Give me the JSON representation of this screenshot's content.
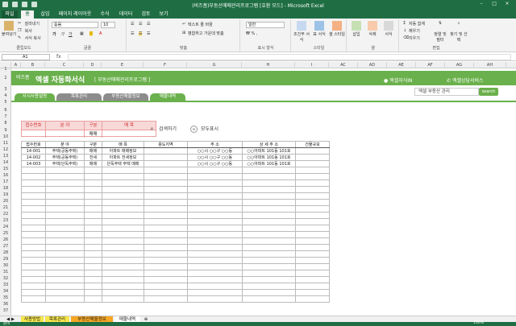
{
  "window": {
    "title": "(비즈폼)부동산매매관리프로그램 [호환 모드] - Microsoft Excel",
    "controls": [
      "–",
      "□",
      "×"
    ]
  },
  "ribbon_tabs": [
    "파일",
    "홈",
    "삽입",
    "페이지 레이아웃",
    "수식",
    "데이터",
    "검토",
    "보기"
  ],
  "ribbon": {
    "clipboard": {
      "paste": "붙여넣기",
      "cut": "잘라내기",
      "copy": "복사",
      "format_painter": "서식 복사",
      "label": "클립보드"
    },
    "font": {
      "name": "돋움",
      "size": "10",
      "label": "글꼴"
    },
    "alignment": {
      "wrap": "텍스트 줄 바꿈",
      "merge": "병합하고 가운데 맞춤",
      "label": "맞춤"
    },
    "number": {
      "format": "일반",
      "label": "표시 형식"
    },
    "styles": {
      "conditional": "조건부 서식",
      "table": "표 서식",
      "cell": "셀 스타일",
      "label": "스타일"
    },
    "cells": {
      "insert": "삽입",
      "delete": "삭제",
      "format": "서식",
      "label": "셀"
    },
    "editing": {
      "autosum": "자동 합계",
      "fill": "채우기",
      "clear": "지우기",
      "sort": "정렬 및 필터",
      "find": "찾기 및 선택",
      "label": "편집"
    }
  },
  "formula_bar": {
    "name_box": "A1",
    "fx": "fx",
    "value": ""
  },
  "columns": [
    "A",
    "B",
    "C",
    "D",
    "E",
    "F",
    "G",
    "H",
    "I",
    "AC",
    "AD",
    "AE",
    "AF",
    "AG",
    "AH"
  ],
  "rows": [
    "1",
    "2",
    "3",
    "4",
    "5",
    "6",
    "7",
    "8",
    "9",
    "10",
    "11",
    "12",
    "13",
    "14",
    "15",
    "16",
    "17",
    "18",
    "19",
    "20",
    "21",
    "22",
    "23",
    "24",
    "25",
    "26",
    "27",
    "28",
    "29",
    "30",
    "31",
    "32",
    "33",
    "34",
    "35",
    "36",
    "37"
  ],
  "banner": {
    "brand": "비즈폼",
    "title": "엑셀 자동화서식",
    "subtitle": "[ 부동산매매관리프로그램 ]",
    "link1": "엑셀자식IN",
    "link2": "엑셀상담서비스",
    "search_placeholder": "엑셀 부동산 관리",
    "search_button": "search"
  },
  "nav_tabs": [
    "사시사용설명",
    "목록관리",
    "부동산매물정보",
    "매물내역"
  ],
  "filter": {
    "headers": [
      "접수번호",
      "분 야",
      "구분",
      "매 목"
    ],
    "values": [
      "",
      "",
      "매매",
      ""
    ]
  },
  "actions": {
    "search": "검색하기",
    "show_all": "모두표시"
  },
  "table": {
    "headers": [
      "접수번호",
      "분 야",
      "구분",
      "매 목",
      "용도지역",
      "주 소",
      "상 세 주 소",
      "건물규모"
    ],
    "rows": [
      [
        "14-001",
        "주택(공동주택)",
        "매매",
        "아파트 매매정보",
        "",
        "○○시 ○○구 ○○동",
        "○○아파트 101동 101호",
        ""
      ],
      [
        "14-002",
        "주택(공동주택)",
        "전세",
        "아파트 전세정보",
        "",
        "○○시 ○○구 ○○동",
        "○○아파트 101동 101호",
        ""
      ],
      [
        "14-003",
        "주택(단독주택)",
        "매매",
        "단독주택 주택 매매",
        "",
        "○○시 ○○구 ○○동",
        "○○아파트 101동 101호",
        ""
      ]
    ]
  },
  "sheet_tabs": [
    "사용방법",
    "목록관리",
    "부동산매물정보",
    "매물내역"
  ],
  "status": {
    "ready": "준비",
    "zoom": "100%"
  }
}
